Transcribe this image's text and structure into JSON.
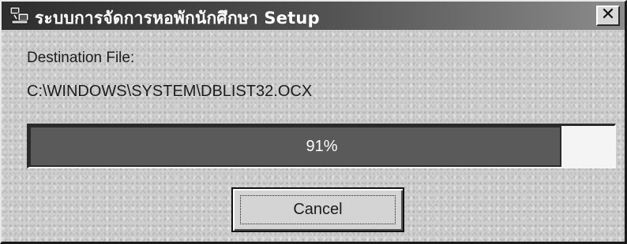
{
  "window": {
    "title": "ระบบการจัดการหอพักนักศึกษา Setup",
    "close_symbol": "✕",
    "app_icon": "setup-computer-icon"
  },
  "content": {
    "destination_label": "Destination File:",
    "destination_path": "C:\\WINDOWS\\SYSTEM\\DBLIST32.OCX"
  },
  "progress": {
    "percent": 91,
    "text": "91%"
  },
  "buttons": {
    "cancel_label": "Cancel"
  },
  "colors": {
    "title_bar": "#2e2e2e",
    "progress_fill": "#5a5a5a",
    "window_bg": "#cfcfcf"
  }
}
